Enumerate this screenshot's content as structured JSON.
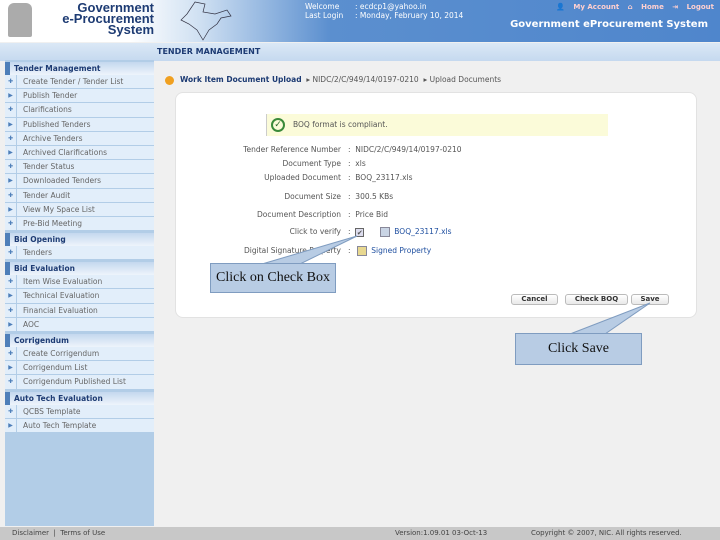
{
  "header": {
    "logo_lines": [
      "Government",
      "e-Procurement",
      "System"
    ],
    "welcome_label": "Welcome",
    "welcome_value": ": ecdcp1@yahoo.in",
    "lastlogin_label": "Last Login",
    "lastlogin_value": ": Monday, February 10, 2014",
    "links": [
      "My Account",
      "Home",
      "Logout"
    ],
    "system_name": "Government eProcurement System"
  },
  "strip": {
    "title": "TENDER MANAGEMENT"
  },
  "sidebar": [
    {
      "title": "Tender Management",
      "items": [
        "Create Tender / Tender List",
        "Publish Tender",
        "Clarifications",
        "Published Tenders",
        "Archive Tenders",
        "Archived Clarifications",
        "Tender Status",
        "Downloaded Tenders",
        "Tender Audit",
        "View My Space List",
        "Pre-Bid Meeting"
      ]
    },
    {
      "title": "Bid Opening",
      "items": [
        "Tenders"
      ]
    },
    {
      "title": "Bid Evaluation",
      "items": [
        "Item Wise Evaluation",
        "Technical Evaluation",
        "Financial Evaluation",
        "AOC"
      ]
    },
    {
      "title": "Corrigendum",
      "items": [
        "Create Corrigendum",
        "Corrigendum List",
        "Corrigendum Published List"
      ]
    },
    {
      "title": "Auto Tech Evaluation",
      "items": [
        "QCBS Template",
        "Auto Tech Template"
      ]
    }
  ],
  "breadcrumb": [
    "Work Item Document Upload",
    "NIDC/2/C/949/14/0197-0210",
    "Upload Documents"
  ],
  "message": "BOQ format is compliant.",
  "fields": [
    {
      "label": "Tender Reference Number",
      "value": "NIDC/2/C/949/14/0197-0210"
    },
    {
      "label": "Document Type",
      "value": "xls"
    },
    {
      "label": "Uploaded Document",
      "value": "BOQ_23117.xls"
    },
    {
      "label": "Document Size",
      "value": "300.5 KBs"
    },
    {
      "label": "Document Description",
      "value": "Price Bid"
    },
    {
      "label": "Click to verify",
      "value": "BOQ_23117.xls"
    },
    {
      "label": "Digital Signature Property",
      "value": "Signed Property"
    }
  ],
  "verify_checked": true,
  "buttons": {
    "cancel": "Cancel",
    "check": "Check BOQ",
    "save": "Save"
  },
  "callouts": {
    "checkbox": "Click on Check Box",
    "save": "Click Save"
  },
  "footer": {
    "disclaimer": "Disclaimer",
    "sep": "|",
    "terms": "Terms of Use",
    "version": "Version:1.09.01 03-Oct-13",
    "copyright": "Copyright © 2007, NIC. All rights reserved."
  }
}
